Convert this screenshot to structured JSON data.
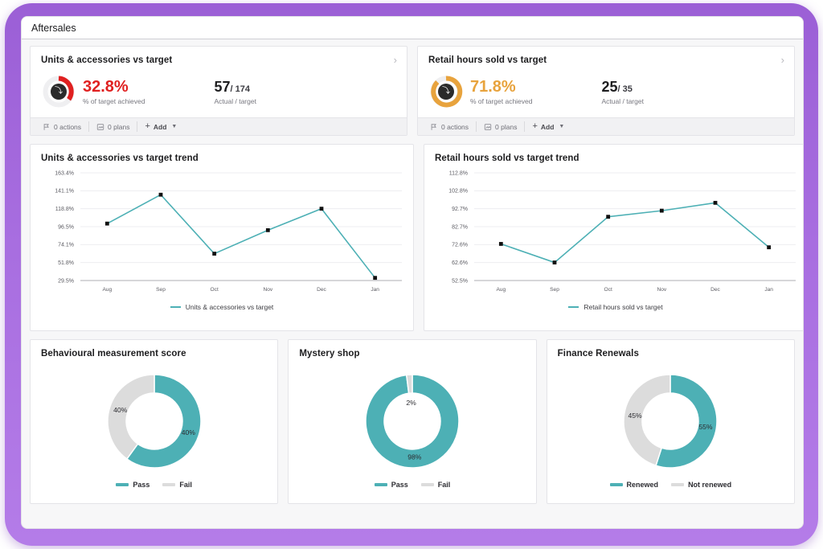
{
  "page": {
    "title": "Aftersales"
  },
  "colors": {
    "teal": "#4db0b5",
    "grey": "#dcdcdc",
    "red": "#e02020",
    "orange": "#e8a33d",
    "frame_purple": "#a86ee0"
  },
  "kpis": [
    {
      "title": "Units & accessories vs target",
      "percent": "32.8%",
      "percent_color": "#e02020",
      "percent_caption": "% of target achieved",
      "actual": "57",
      "target": "/ 174",
      "actual_caption": "Actual / target",
      "gauge_fraction": 0.328,
      "footer": {
        "actions": "0 actions",
        "plans": "0 plans",
        "add": "Add"
      }
    },
    {
      "title": "Retail hours sold vs target",
      "percent": "71.8%",
      "percent_color": "#e8a33d",
      "percent_caption": "% of target achieved",
      "actual": "25",
      "target": "/ 35",
      "actual_caption": "Actual / target",
      "gauge_fraction": 0.718,
      "footer": {
        "actions": "0 actions",
        "plans": "0 plans",
        "add": "Add"
      }
    }
  ],
  "chart_data": [
    {
      "type": "line",
      "title": "Units & accessories vs target trend",
      "categories": [
        "Aug",
        "Sep",
        "Oct",
        "Nov",
        "Dec",
        "Jan"
      ],
      "series": [
        {
          "name": "Units & accessories vs target",
          "values": [
            100.3,
            136.2,
            62.9,
            92.1,
            118.8,
            32.8
          ]
        }
      ],
      "yticks": [
        "163.4%",
        "141.1%",
        "118.8%",
        "96.5%",
        "74.1%",
        "51.8%",
        "29.5%"
      ],
      "ylim": [
        29.5,
        163.4
      ],
      "xlabel": "",
      "ylabel": "",
      "grid": true,
      "legend": "bottom",
      "line_color": "#4db0b5",
      "marker_color": "#111111"
    },
    {
      "type": "line",
      "title": "Retail hours sold vs target trend",
      "categories": [
        "Aug",
        "Sep",
        "Oct",
        "Nov",
        "Dec",
        "Jan"
      ],
      "series": [
        {
          "name": "Retail hours sold vs target",
          "values": [
            73.0,
            62.6,
            88.2,
            91.6,
            96.0,
            71.1
          ]
        }
      ],
      "yticks": [
        "112.8%",
        "102.8%",
        "92.7%",
        "82.7%",
        "72.6%",
        "62.6%",
        "52.5%"
      ],
      "ylim": [
        52.5,
        112.8
      ],
      "xlabel": "",
      "ylabel": "",
      "grid": true,
      "legend": "bottom",
      "line_color": "#4db0b5",
      "marker_color": "#111111"
    },
    {
      "type": "pie",
      "title": "Behavioural measurement score",
      "labels": [
        "Pass",
        "Fail"
      ],
      "values": [
        60,
        40
      ],
      "display_labels": [
        "40%",
        "40%"
      ],
      "colors": [
        "#4db0b5",
        "#dcdcdc"
      ],
      "legend": "bottom"
    },
    {
      "type": "pie",
      "title": "Mystery shop",
      "labels": [
        "Pass",
        "Fail"
      ],
      "values": [
        98,
        2
      ],
      "display_labels": [
        "98%",
        "2%"
      ],
      "colors": [
        "#4db0b5",
        "#dcdcdc"
      ],
      "legend": "bottom"
    },
    {
      "type": "pie",
      "title": "Finance Renewals",
      "labels": [
        "Renewed",
        "Not renewed"
      ],
      "values": [
        55,
        45
      ],
      "display_labels": [
        "55%",
        "45%"
      ],
      "colors": [
        "#4db0b5",
        "#dcdcdc"
      ],
      "legend": "bottom"
    }
  ]
}
